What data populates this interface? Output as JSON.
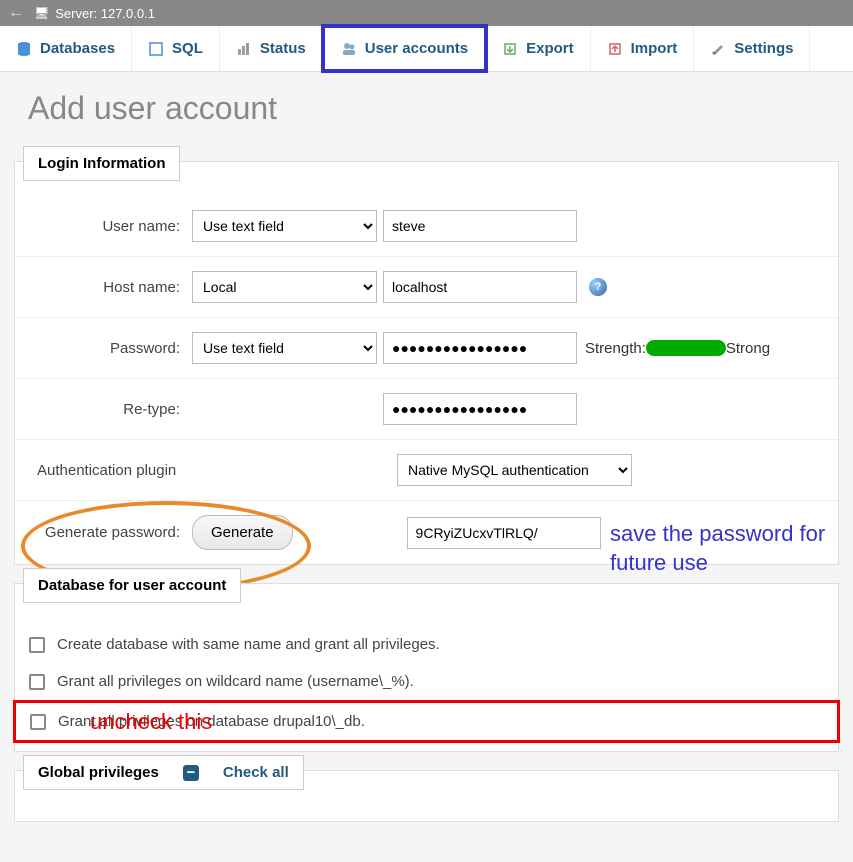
{
  "topbar": {
    "back": "←",
    "server_label": "Server: 127.0.0.1"
  },
  "tabs": {
    "databases": "Databases",
    "sql": "SQL",
    "status": "Status",
    "user_accounts": "User accounts",
    "export": "Export",
    "import": "Import",
    "settings": "Settings"
  },
  "page_title": "Add user account",
  "login": {
    "legend": "Login Information",
    "username_label": "User name:",
    "username_mode": "Use text field",
    "username_value": "steve",
    "hostname_label": "Host name:",
    "hostname_mode": "Local",
    "hostname_value": "localhost",
    "password_label": "Password:",
    "password_mode": "Use text field",
    "password_value": "●●●●●●●●●●●●●●●●",
    "strength_label": "Strength:",
    "strength_text": "Strong",
    "retype_label": "Re-type:",
    "retype_value": "●●●●●●●●●●●●●●●●",
    "auth_label": "Authentication plugin",
    "auth_value": "Native MySQL authentication",
    "gen_label": "Generate password:",
    "gen_button": "Generate",
    "gen_value": "9CRyiZUcxvTlRLQ/"
  },
  "dbaccount": {
    "legend": "Database for user account",
    "opt1": "Create database with same name and grant all privileges.",
    "opt2": "Grant all privileges on wildcard name (username\\_%).",
    "opt3": "Grant all privileges on database drupal10\\_db."
  },
  "global": {
    "legend": "Global privileges",
    "check_all": "Check all"
  },
  "annotations": {
    "save_pw": "save the password for future use",
    "uncheck": "uncheck this"
  }
}
